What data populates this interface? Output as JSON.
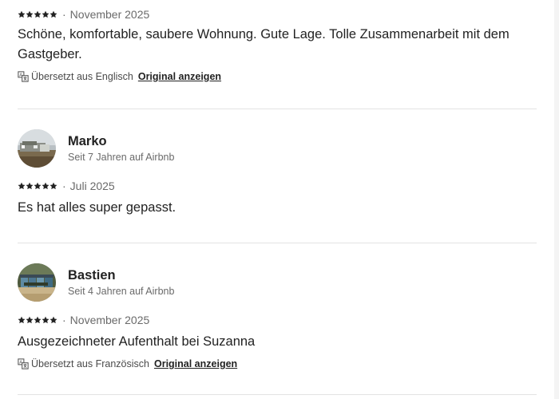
{
  "reviews": [
    {
      "rating": 5,
      "separator": "·",
      "date": "November 2025",
      "text": "Schöne, komfortable, saubere Wohnung. Gute Lage. Tolle Zusammenarbeit mit dem Gastgeber.",
      "translation_note": "Übersetzt aus Englisch",
      "original_link": "Original anzeigen"
    },
    {
      "reviewer_name": "Marko",
      "reviewer_since": "Seit 7 Jahren auf Airbnb",
      "rating": 5,
      "separator": "·",
      "date": "Juli 2025",
      "text": "Es hat alles super gepasst."
    },
    {
      "reviewer_name": "Bastien",
      "reviewer_since": "Seit 4 Jahren auf Airbnb",
      "rating": 5,
      "separator": "·",
      "date": "November 2025",
      "text": "Ausgezeichneter Aufenthalt bei Suzanna",
      "translation_note": "Übersetzt aus Französisch",
      "original_link": "Original anzeigen"
    }
  ],
  "icons": {
    "star": "star-icon",
    "translate": "translate-icon"
  },
  "colors": {
    "text": "#222222",
    "muted": "#6a6a6a",
    "divider": "#e3e3e3",
    "star": "#222222"
  }
}
